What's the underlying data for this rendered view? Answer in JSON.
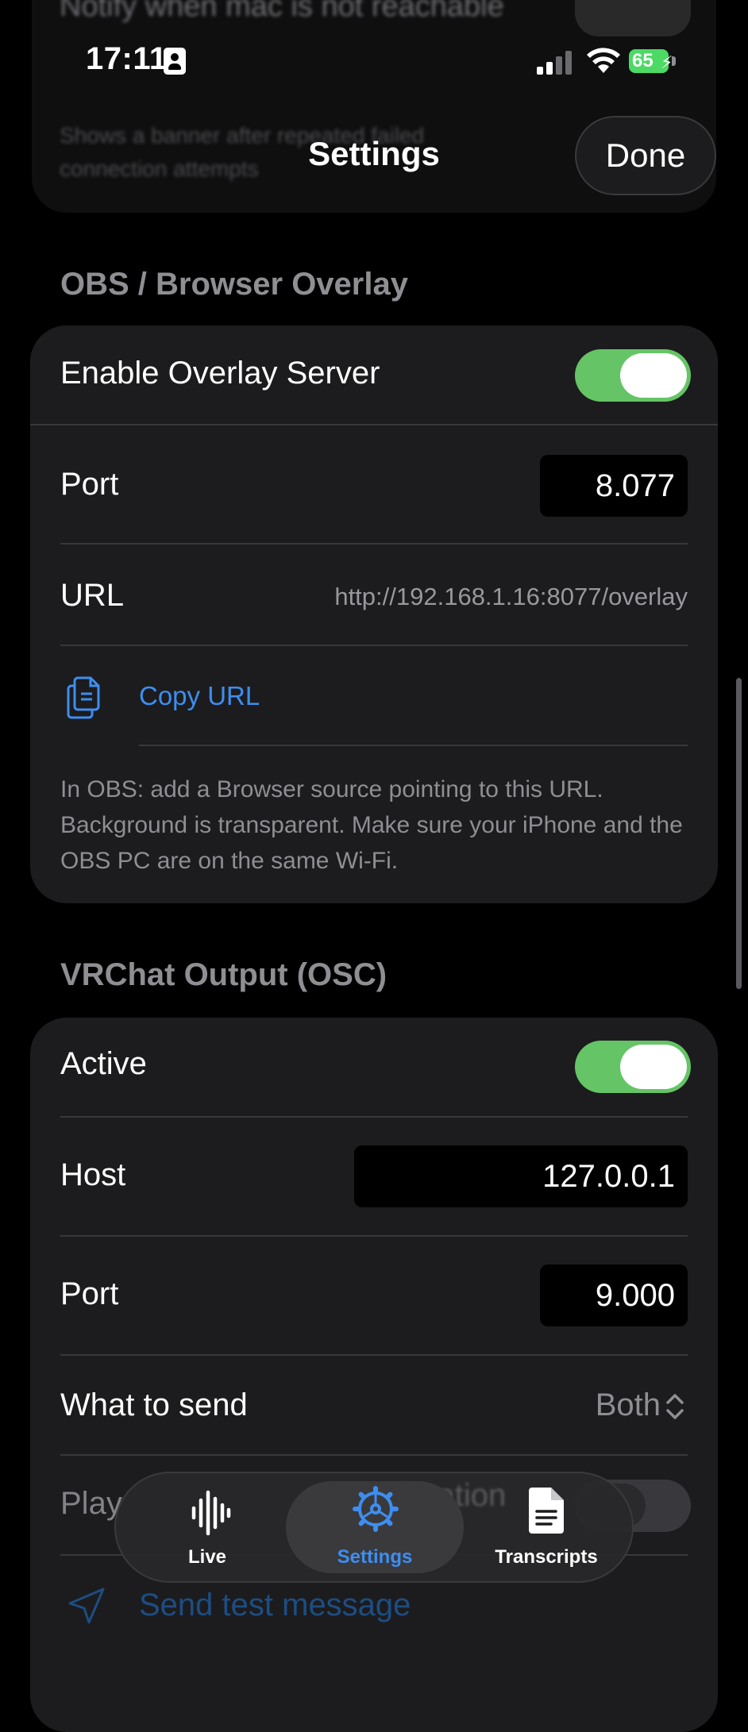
{
  "status_bar": {
    "time": "17:11",
    "battery_level": "65"
  },
  "ghost_section": {
    "title": "Notify when mac is not reachable",
    "description": "Shows a banner after repeated failed connection attempts"
  },
  "nav": {
    "title": "Settings",
    "done_label": "Done"
  },
  "obs": {
    "header": "OBS / Browser Overlay",
    "enable_label": "Enable Overlay Server",
    "enable_on": true,
    "port_label": "Port",
    "port_value": "8.077",
    "url_label": "URL",
    "url_value": "http://192.168.1.16:8077/overlay",
    "copy_label": "Copy URL",
    "help_text": "In OBS: add a Browser source pointing to this URL. Background is transparent. Make sure your iPhone and the OBS PC are on the same Wi-Fi."
  },
  "vrchat": {
    "header": "VRChat Output (OSC)",
    "active_label": "Active",
    "active_on": true,
    "host_label": "Host",
    "host_value": "127.0.0.1",
    "port_label": "Port",
    "port_value": "9.000",
    "what_label": "What to send",
    "what_value": "Both",
    "play_label": "Play",
    "notification_label": "notification",
    "send_test_label": "Send test message"
  },
  "tabs": [
    {
      "label": "Live",
      "icon": "waveform-icon"
    },
    {
      "label": "Settings",
      "icon": "gear-icon",
      "active": true
    },
    {
      "label": "Transcripts",
      "icon": "document-icon"
    }
  ],
  "colors": {
    "accent": "#3d8ef0",
    "toggle_on": "#65c466",
    "card": "#1c1c1e"
  }
}
